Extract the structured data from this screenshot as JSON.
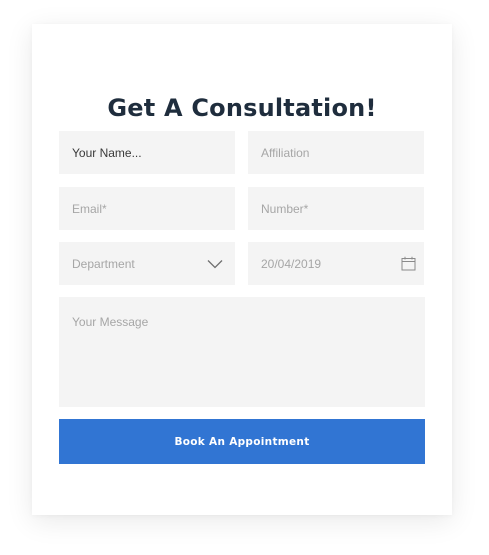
{
  "form": {
    "title": "Get A Consultation!",
    "name_field": {
      "value": "Your Name..."
    },
    "affiliation_field": {
      "placeholder": "Affiliation"
    },
    "email_field": {
      "placeholder": "Email*"
    },
    "number_field": {
      "placeholder": "Number*"
    },
    "department_select": {
      "selected": "Department",
      "icon": "chevron-down-icon"
    },
    "date_field": {
      "value": "20/04/2019",
      "icon": "calendar-icon"
    },
    "message_field": {
      "placeholder": "Your Message"
    },
    "submit_label": "Book An Appointment"
  },
  "colors": {
    "title": "#1f2d3d",
    "field_background": "#f4f4f4",
    "placeholder_text": "#a6a6a6",
    "button_background": "#3175d3",
    "button_text": "#ffffff"
  }
}
